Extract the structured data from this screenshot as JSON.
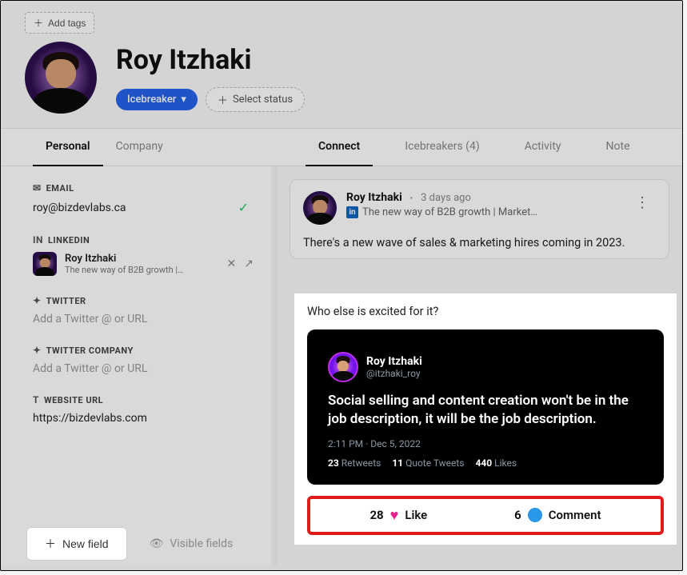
{
  "header": {
    "add_tags": "Add tags",
    "name": "Roy Itzhaki",
    "pill_label": "Icebreaker",
    "select_status": "Select status"
  },
  "tabs_left": {
    "personal": "Personal",
    "company": "Company"
  },
  "tabs_right": {
    "connect": "Connect",
    "icebreakers": "Icebreakers (4)",
    "activity": "Activity",
    "note": "Note"
  },
  "fields": {
    "email_label": "EMAIL",
    "email_value": "roy@bizdevlabs.ca",
    "linkedin_label": "LINKEDIN",
    "linkedin_name": "Roy Itzhaki",
    "linkedin_headline": "The new way of B2B growth |…",
    "twitter_label": "TWITTER",
    "twitter_placeholder": "Add a Twitter @ or URL",
    "twitter_company_label": "TWITTER COMPANY",
    "twitter_company_placeholder": "Add a Twitter @ or URL",
    "website_label": "WEBSITE URL",
    "website_value": "https://bizdevlabs.com"
  },
  "bottom": {
    "new_field": "New field",
    "visible_fields": "Visible fields"
  },
  "post": {
    "author": "Roy Itzhaki",
    "time": "3 days ago",
    "subline": "The new way of B2B growth | Market…",
    "body_line1": "There's a new wave of sales & marketing hires coming in 2023.",
    "question": "Who else is excited for it?"
  },
  "tweet": {
    "name": "Roy Itzhaki",
    "handle": "@itzhaki_roy",
    "text": "Social selling and content creation won't be in the job description, it will be the job description.",
    "time": "2:11 PM",
    "date": "Dec 5, 2022",
    "retweets": "23",
    "retweets_label": "Retweets",
    "quotes": "11",
    "quotes_label": "Quote Tweets",
    "likes": "440",
    "likes_label": "Likes"
  },
  "engagement": {
    "like_count": "28",
    "like_label": "Like",
    "comment_count": "6",
    "comment_label": "Comment"
  }
}
